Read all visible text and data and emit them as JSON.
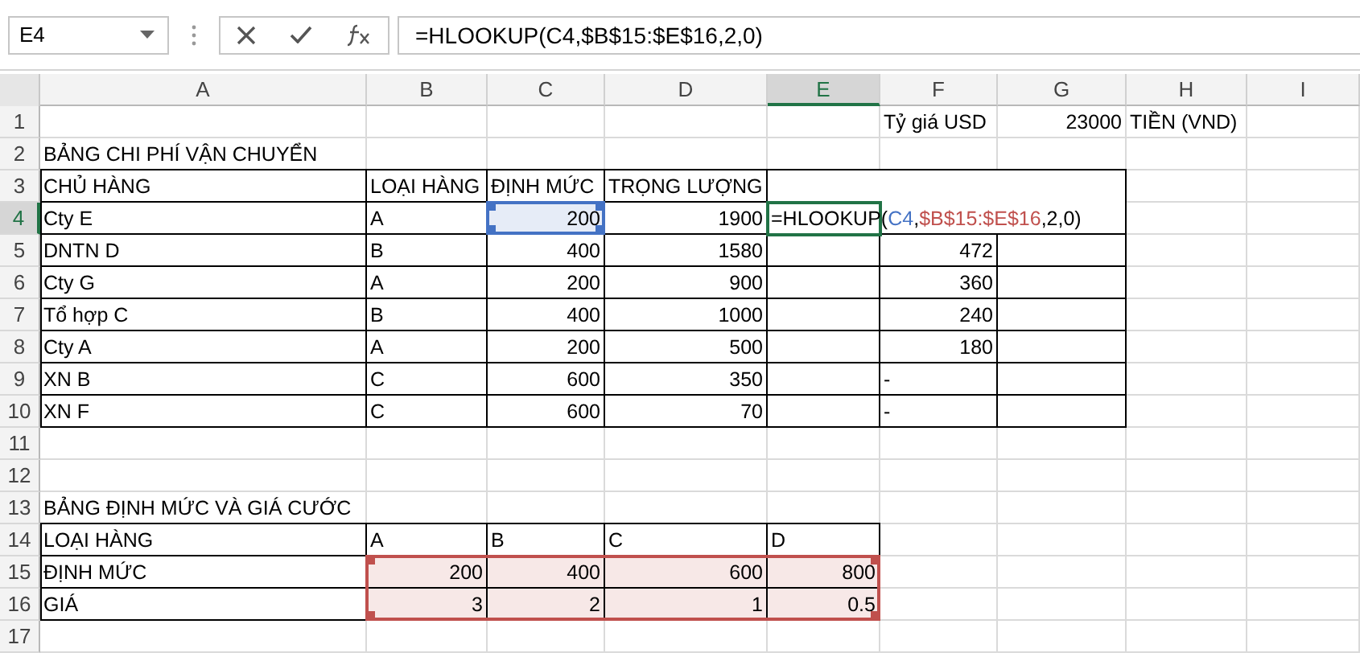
{
  "name_box": {
    "value": "E4"
  },
  "formula_bar": {
    "value": "=HLOOKUP(C4,$B$15:$E$16,2,0)"
  },
  "columns": [
    {
      "label": "A",
      "selected": false
    },
    {
      "label": "B",
      "selected": false
    },
    {
      "label": "C",
      "selected": false
    },
    {
      "label": "D",
      "selected": false
    },
    {
      "label": "E",
      "selected": true
    },
    {
      "label": "F",
      "selected": false
    },
    {
      "label": "G",
      "selected": false
    },
    {
      "label": "H",
      "selected": false
    },
    {
      "label": "I",
      "selected": false
    }
  ],
  "rows": [
    {
      "label": "1",
      "selected": false,
      "cells": [
        null,
        null,
        null,
        null,
        null,
        {
          "kind": "text",
          "text": "Tỷ giá USD"
        },
        {
          "kind": "number",
          "text": "23000"
        },
        {
          "kind": "text",
          "text": "TIỀN (VND)"
        }
      ]
    },
    {
      "label": "2",
      "selected": false,
      "cells": [
        {
          "kind": "text",
          "text": "BẢNG CHI PHÍ VẬN CHUYỂN"
        }
      ]
    },
    {
      "label": "3",
      "selected": false,
      "cells": [
        {
          "kind": "text",
          "text": "CHỦ HÀNG"
        },
        {
          "kind": "text",
          "text": "LOẠI HÀNG"
        },
        {
          "kind": "text",
          "text": "ĐỊNH MỨC"
        },
        {
          "kind": "text",
          "text": "TRỌNG LƯỢNG"
        }
      ]
    },
    {
      "label": "4",
      "selected": true,
      "cells": [
        {
          "kind": "text",
          "text": "Cty E"
        },
        {
          "kind": "text",
          "text": "A"
        },
        {
          "kind": "number",
          "text": "200",
          "color": "#4472c4"
        },
        {
          "kind": "number",
          "text": "1900"
        },
        {
          "kind": "formula",
          "active": true,
          "parts": [
            {
              "text": "=HLOOKUP("
            },
            {
              "text": "C4",
              "color": "#4472c4"
            },
            {
              "text": ","
            },
            {
              "text": "$B$15:$E$16",
              "color": "#c0504d"
            },
            {
              "text": ",2,0)"
            }
          ]
        }
      ]
    },
    {
      "label": "5",
      "selected": false,
      "cells": [
        {
          "kind": "text",
          "text": "DNTN D"
        },
        {
          "kind": "text",
          "text": "B"
        },
        {
          "kind": "number",
          "text": "400"
        },
        {
          "kind": "number",
          "text": "1580"
        },
        null,
        {
          "kind": "number",
          "text": "472"
        }
      ]
    },
    {
      "label": "6",
      "selected": false,
      "cells": [
        {
          "kind": "text",
          "text": "Cty G"
        },
        {
          "kind": "text",
          "text": "A"
        },
        {
          "kind": "number",
          "text": "200"
        },
        {
          "kind": "number",
          "text": "900"
        },
        null,
        {
          "kind": "number",
          "text": "360"
        }
      ]
    },
    {
      "label": "7",
      "selected": false,
      "cells": [
        {
          "kind": "text",
          "text": "Tổ hợp C"
        },
        {
          "kind": "text",
          "text": "B"
        },
        {
          "kind": "number",
          "text": "400"
        },
        {
          "kind": "number",
          "text": "1000"
        },
        null,
        {
          "kind": "number",
          "text": "240"
        }
      ]
    },
    {
      "label": "8",
      "selected": false,
      "cells": [
        {
          "kind": "text",
          "text": "Cty A"
        },
        {
          "kind": "text",
          "text": "A"
        },
        {
          "kind": "number",
          "text": "200"
        },
        {
          "kind": "number",
          "text": "500"
        },
        null,
        {
          "kind": "number",
          "text": "180"
        }
      ]
    },
    {
      "label": "9",
      "selected": false,
      "cells": [
        {
          "kind": "text",
          "text": "XN B"
        },
        {
          "kind": "text",
          "text": "C"
        },
        {
          "kind": "number",
          "text": "600"
        },
        {
          "kind": "number",
          "text": "350"
        },
        null,
        {
          "kind": "text",
          "text": "-"
        }
      ]
    },
    {
      "label": "10",
      "selected": false,
      "cells": [
        {
          "kind": "text",
          "text": "XN F"
        },
        {
          "kind": "text",
          "text": "C"
        },
        {
          "kind": "number",
          "text": "600"
        },
        {
          "kind": "number",
          "text": "70"
        },
        null,
        {
          "kind": "text",
          "text": "-"
        }
      ]
    },
    {
      "label": "11",
      "selected": false,
      "cells": []
    },
    {
      "label": "12",
      "selected": false,
      "cells": []
    },
    {
      "label": "13",
      "selected": false,
      "cells": [
        {
          "kind": "text",
          "text": "BẢNG ĐỊNH MỨC VÀ GIÁ CƯỚC"
        }
      ]
    },
    {
      "label": "14",
      "selected": false,
      "cells": [
        {
          "kind": "text",
          "text": "LOẠI HÀNG"
        },
        {
          "kind": "text",
          "text": "A"
        },
        {
          "kind": "text",
          "text": "B"
        },
        {
          "kind": "text",
          "text": "C"
        },
        {
          "kind": "text",
          "text": "D"
        }
      ]
    },
    {
      "label": "15",
      "selected": false,
      "cells": [
        {
          "kind": "text",
          "text": "ĐỊNH MỨC"
        },
        {
          "kind": "number",
          "text": "200",
          "color": "#c0504d"
        },
        {
          "kind": "number",
          "text": "400",
          "color": "#c0504d"
        },
        {
          "kind": "number",
          "text": "600",
          "color": "#c0504d"
        },
        {
          "kind": "number",
          "text": "800",
          "color": "#c0504d"
        }
      ]
    },
    {
      "label": "16",
      "selected": false,
      "cells": [
        {
          "kind": "text",
          "text": "GIÁ"
        },
        {
          "kind": "number",
          "text": "3",
          "color": "#c0504d"
        },
        {
          "kind": "number",
          "text": "2",
          "color": "#c0504d"
        },
        {
          "kind": "number",
          "text": "1",
          "color": "#c0504d"
        },
        {
          "kind": "number",
          "text": "0.5",
          "color": "#c0504d"
        }
      ]
    },
    {
      "label": "17",
      "selected": false,
      "cells": []
    }
  ]
}
